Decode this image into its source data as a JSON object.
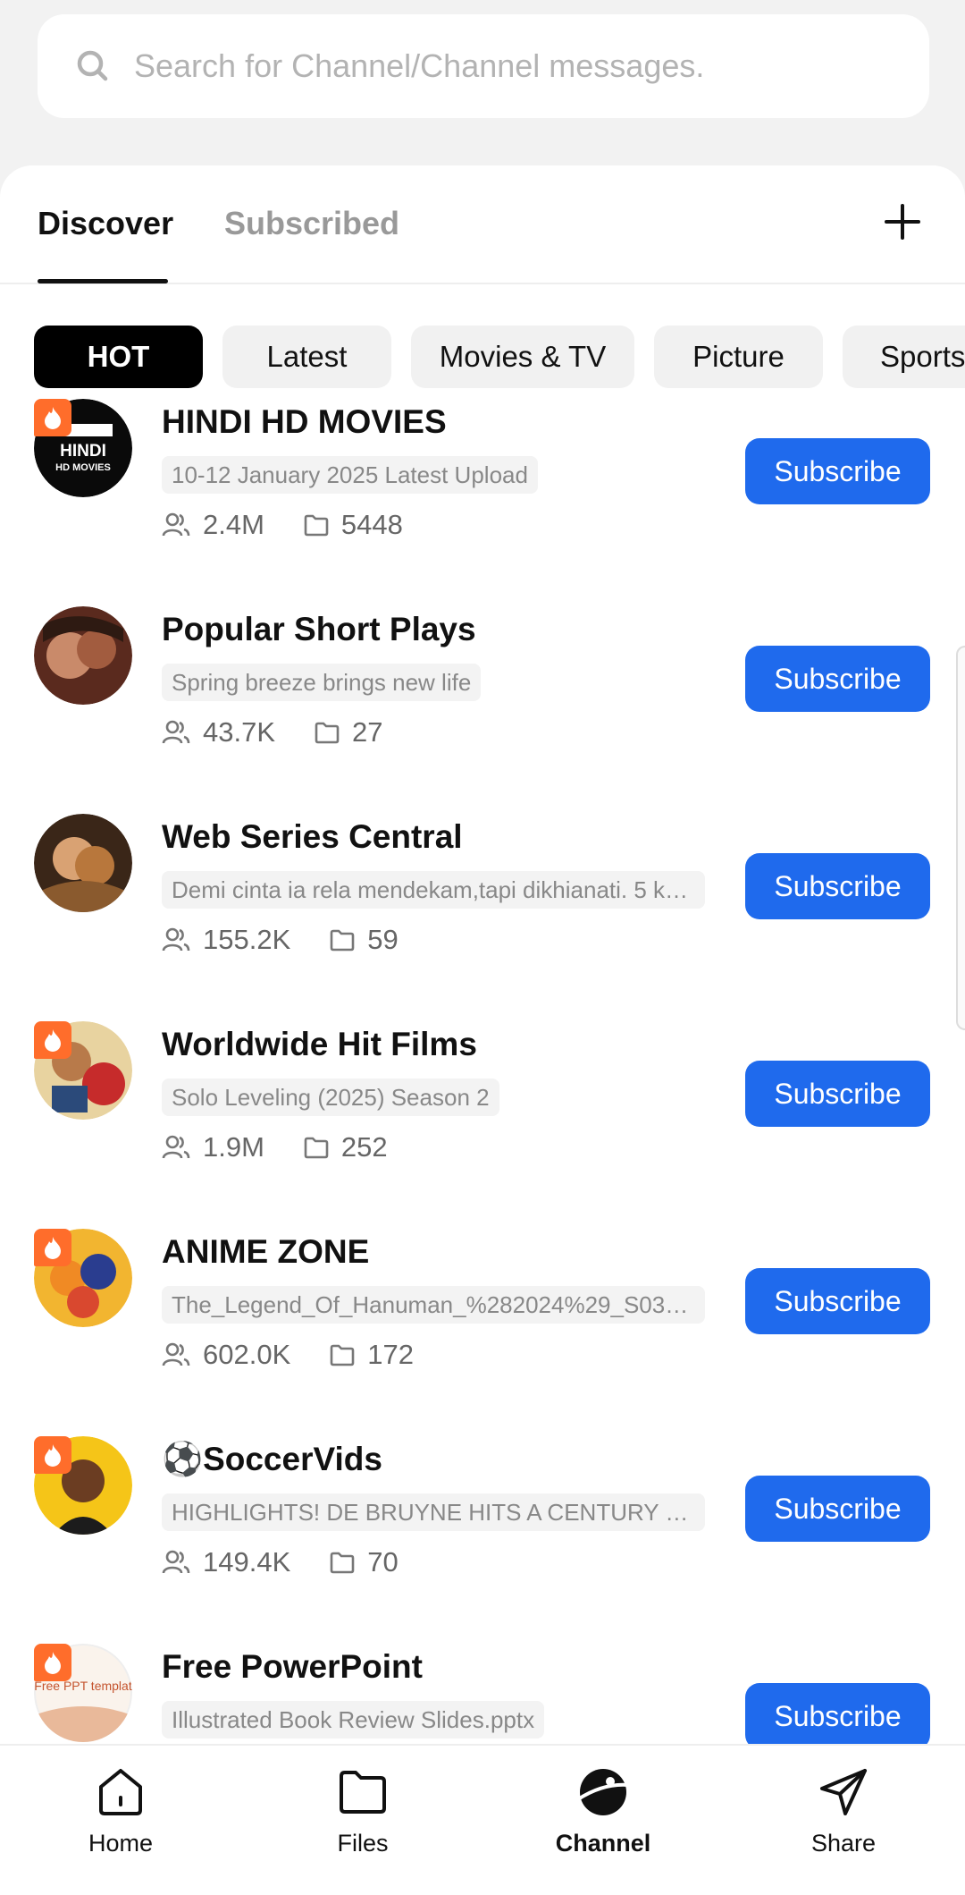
{
  "search": {
    "placeholder": "Search for Channel/Channel messages."
  },
  "tabs": [
    {
      "label": "Discover",
      "active": true
    },
    {
      "label": "Subscribed",
      "active": false
    }
  ],
  "categories": [
    {
      "label": "HOT",
      "active": true
    },
    {
      "label": "Latest",
      "active": false
    },
    {
      "label": "Movies & TV",
      "active": false
    },
    {
      "label": "Picture",
      "active": false
    },
    {
      "label": "Sports",
      "active": false
    }
  ],
  "channels": [
    {
      "name": "HINDI HD MOVIES",
      "description": "10-12 January 2025 Latest Upload",
      "members": "2.4M",
      "files": "5448",
      "hot": true,
      "subscribe_label": "Subscribe",
      "avatar_text": "HINDI HD MOVIES"
    },
    {
      "name": "Popular Short Plays",
      "description": "Spring breeze brings new life",
      "members": "43.7K",
      "files": "27",
      "hot": false,
      "subscribe_label": "Subscribe",
      "avatar_text": ""
    },
    {
      "name": "Web Series Central",
      "description": "Demi cinta ia rela mendekam,tapi dikhianati. 5 ke...",
      "members": "155.2K",
      "files": "59",
      "hot": false,
      "subscribe_label": "Subscribe",
      "avatar_text": ""
    },
    {
      "name": "Worldwide Hit Films",
      "description": "Solo Leveling (2025) Season 2",
      "members": "1.9M",
      "files": "252",
      "hot": true,
      "subscribe_label": "Subscribe",
      "avatar_text": ""
    },
    {
      "name": "ANIME ZONE",
      "description": "The_Legend_Of_Hanuman_%282024%29_S03_O...",
      "members": "602.0K",
      "files": "172",
      "hot": true,
      "subscribe_label": "Subscribe",
      "avatar_text": ""
    },
    {
      "name": "⚽SoccerVids",
      "description": "HIGHLIGHTS! DE BRUYNE HITS A CENTURY OF ...",
      "members": "149.4K",
      "files": "70",
      "hot": true,
      "subscribe_label": "Subscribe",
      "avatar_text": ""
    },
    {
      "name": "Free PowerPoint",
      "description": "Illustrated Book Review Slides.pptx",
      "members": "",
      "files": "",
      "hot": true,
      "subscribe_label": "Subscribe",
      "avatar_text": "Free PPT templat"
    }
  ],
  "bottom_nav": [
    {
      "label": "Home",
      "icon": "home-icon",
      "active": false
    },
    {
      "label": "Files",
      "icon": "folder-icon",
      "active": false
    },
    {
      "label": "Channel",
      "icon": "channel-icon",
      "active": true
    },
    {
      "label": "Share",
      "icon": "send-icon",
      "active": false
    }
  ],
  "colors": {
    "accent": "#1f6aed",
    "hot_badge": "#ff6d2b",
    "background": "#f2f2f2"
  }
}
